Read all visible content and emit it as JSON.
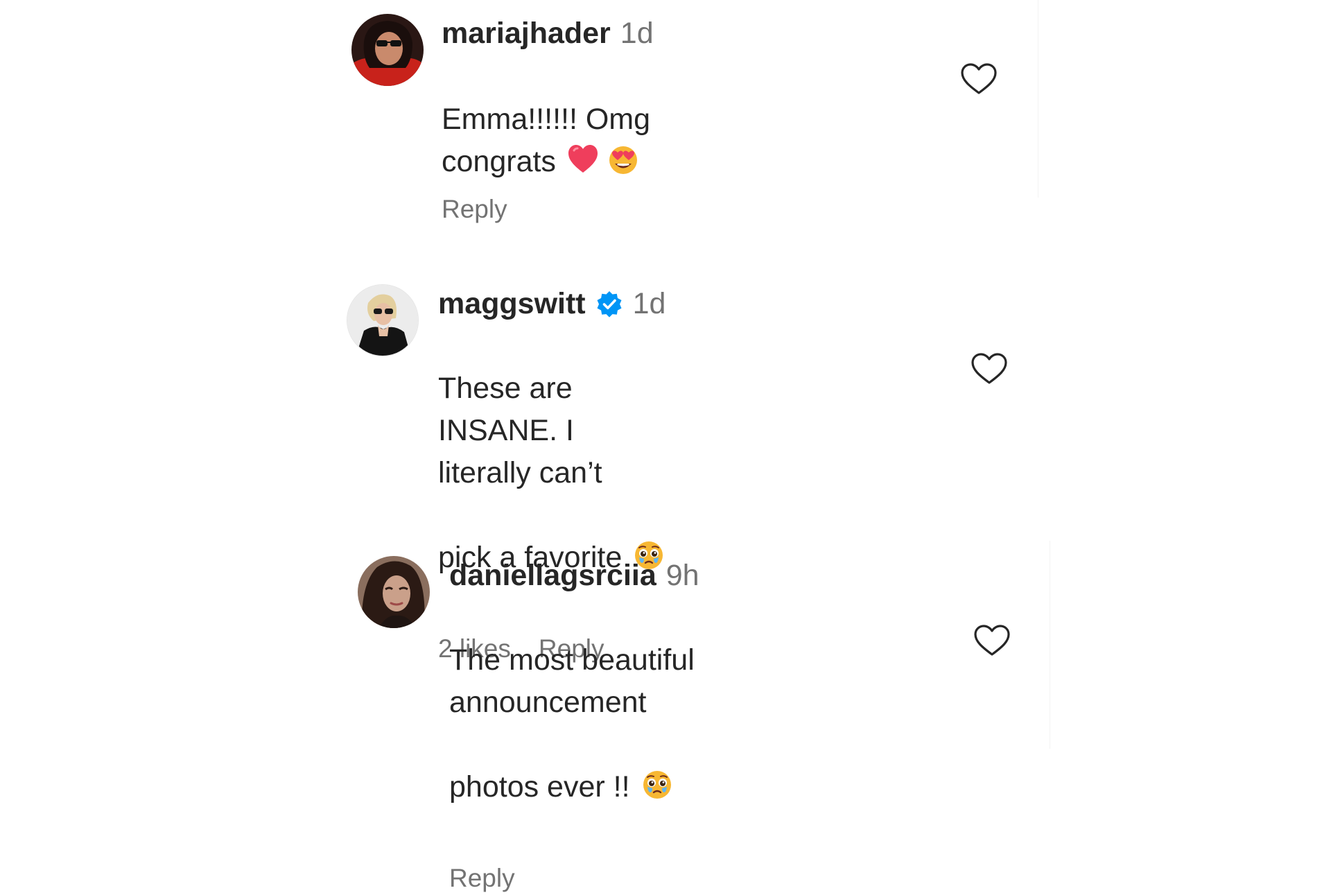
{
  "comments": [
    {
      "username": "mariajhader",
      "timestamp": "1d",
      "verified": false,
      "lines": [
        "Emma!!!!!! Omg congrats"
      ],
      "emojis": [
        "red-heart-emoji",
        "heart-eyes-emoji"
      ],
      "likes": "",
      "reply_label": "Reply"
    },
    {
      "username": "maggswitt",
      "timestamp": "1d",
      "verified": true,
      "lines": [
        "These are INSANE. I literally can’t",
        "pick a favorite"
      ],
      "emojis": [
        "pleading-teary-face-emoji"
      ],
      "likes": "2 likes",
      "reply_label": "Reply"
    },
    {
      "username": "daniellagsrciia",
      "timestamp": "9h",
      "verified": false,
      "lines": [
        "The most beautiful announcement",
        "photos ever !!"
      ],
      "emojis": [
        "pleading-teary-face-emoji"
      ],
      "likes": "",
      "reply_label": "Reply"
    }
  ],
  "colors": {
    "text": "#262626",
    "secondary": "#737373",
    "verified_blue": "#0095f6",
    "heart_red": "#ef3e5c",
    "emoji_yellow": "#f7b733"
  },
  "icons": {
    "like": "heart-outline-icon",
    "verified": "verified-badge-icon"
  }
}
